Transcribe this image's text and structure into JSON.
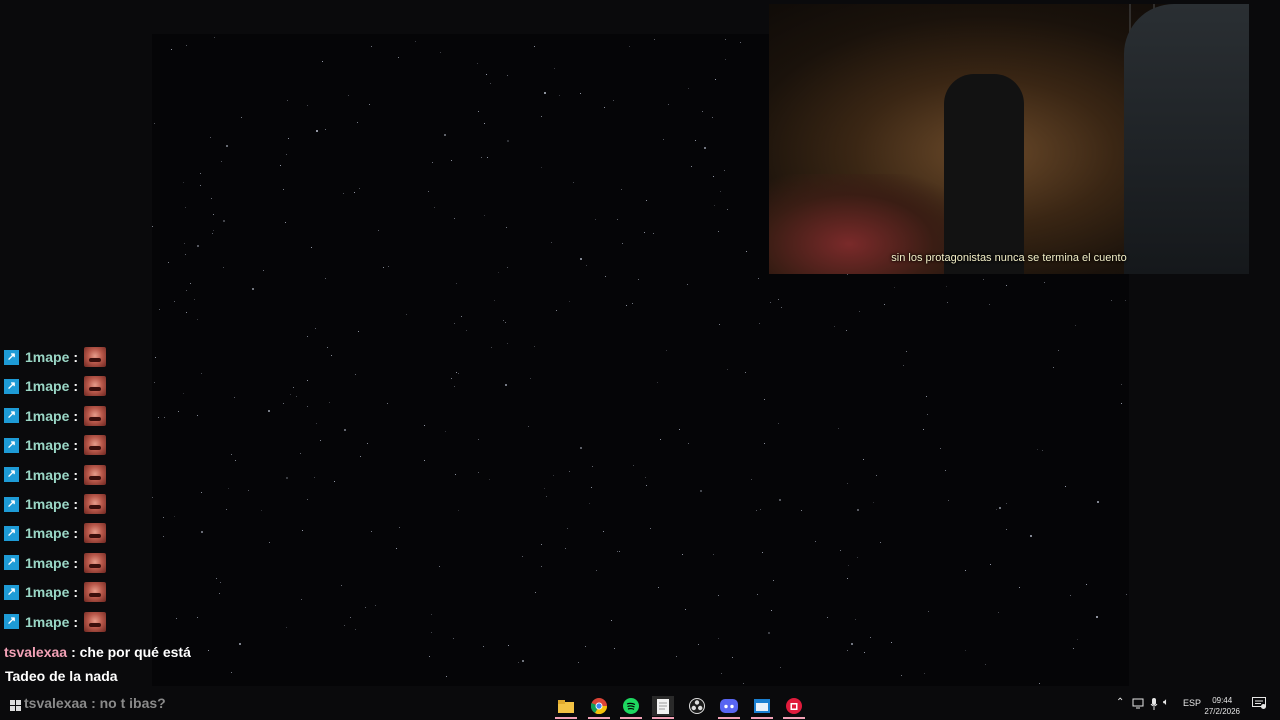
{
  "video": {
    "subtitle": "sin los protagonistas nunca se termina el cuento"
  },
  "chat": {
    "repeated_user": "1mape",
    "separator": ":",
    "repeat_count": 10,
    "last_messages": [
      {
        "user": "tsvalexaa",
        "text": ": che por qué está"
      },
      {
        "user": "",
        "text": "Tadeo de la nada"
      },
      {
        "user": "tsvalexaa",
        "text": ": no t ibas?"
      }
    ]
  },
  "taskbar": {
    "apps": [
      "file-explorer-icon",
      "chrome-icon",
      "spotify-icon",
      "notepad-icon",
      "obs-icon",
      "discord-icon",
      "app-window-icon",
      "red-app-icon"
    ],
    "tray": {
      "language": "ESP",
      "time": "09:44",
      "date": "27/2/2026"
    }
  },
  "colors": {
    "accent_user": "#9ad7c6",
    "chat_user_pink": "#f2a1b6",
    "prime_blue": "#1e9bd6"
  }
}
